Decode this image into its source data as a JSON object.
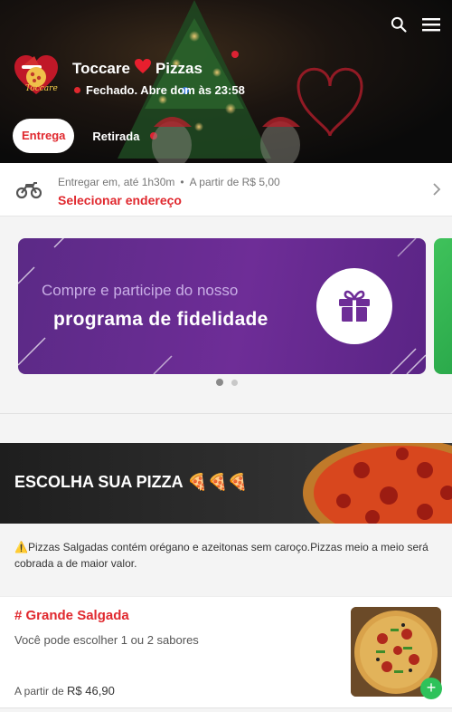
{
  "header": {
    "store_name_part1": "Toccare",
    "store_name_part2": "Pizzas",
    "status": "Fechado. Abre dom às 23:58",
    "logo_text": "Toccare",
    "tabs": [
      {
        "label": "Entrega",
        "active": true
      },
      {
        "label": "Retirada",
        "active": false
      }
    ]
  },
  "delivery": {
    "eta": "Entregar em, até 1h30m",
    "bullet": "•",
    "min_price": "A partir de R$ 5,00",
    "select_label": "Selecionar endereço"
  },
  "banner": {
    "line1": "Compre e participe do nosso",
    "line2": "programa de fidelidade",
    "slides": 2,
    "active_slide": 1
  },
  "category": {
    "title": "ESCOLHA SUA PIZZA",
    "title_emojis": "🍕🍕🍕"
  },
  "notice": "⚠️Pizzas Salgadas contém orégano e azeitonas sem caroço.Pizzas meio a meio será cobrada a de maior valor.",
  "product": {
    "name": "# Grande Salgada",
    "description": "Você pode escolher 1 ou 2 sabores",
    "price_prefix": "A partir de",
    "price": "R$ 46,90",
    "add_label": "+"
  },
  "colors": {
    "accent": "#e0282e",
    "add_button": "#2ec25a",
    "banner_purple": "#6e2d97"
  },
  "icons": [
    "search-icon",
    "menu-icon",
    "heart-icon",
    "motorcycle-icon",
    "chevron-right-icon",
    "gift-icon"
  ]
}
